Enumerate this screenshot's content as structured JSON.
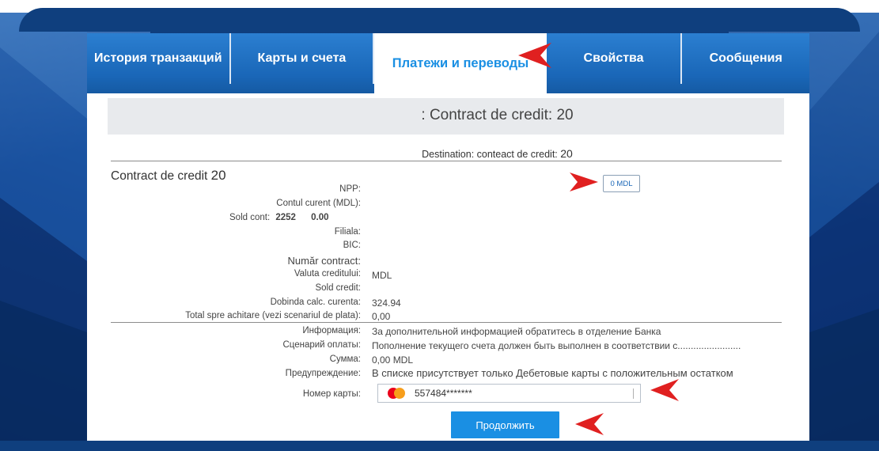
{
  "nav": {
    "tabs": [
      {
        "label": "История транзакций"
      },
      {
        "label": "Карты и счета"
      },
      {
        "label": "Платежи и переводы",
        "active": true
      },
      {
        "label": "Свойства"
      },
      {
        "label": "Сообщения"
      }
    ]
  },
  "header": {
    "title": ": Contract de credit: 20"
  },
  "destination": {
    "prefix": "Destination: conteact de credit:",
    "number": "20"
  },
  "contract": {
    "title": "Contract de credit",
    "number": "20",
    "amount_button": "0 MDL"
  },
  "details": {
    "npp_label": "NPP:",
    "contul_label": "Contul curent (MDL):",
    "sold_cont_label": "Sold cont:",
    "sold_cont_account": "2252",
    "sold_cont_value": "0.00",
    "filiala_label": "Filiala:",
    "bic_label": "BIC:",
    "numar_label": "Număr contract:",
    "valuta_label": "Valuta creditului:",
    "valuta_value": "MDL",
    "sold_credit_label": "Sold credit:",
    "dobinda_label": "Dobinda calc. curenta:",
    "dobinda_value": "324.94",
    "total_label": "Total spre achitare (vezi scenariul de plata):",
    "total_value": "0,00"
  },
  "payment": {
    "info_label": "Информация:",
    "info_value": "За дополнительной информацией обратитесь в отделение Банка",
    "scenario_label": "Сценарий оплаты:",
    "scenario_value": "Пополнение текущего счета должен быть выполнен в соответствии с........................",
    "sum_label": "Сумма:",
    "sum_value": "0,00 MDL",
    "warning_label": "Предупреждение:",
    "warning_value": "В списке присутствует только Дебетовые карты с положительным остатком",
    "card_label": "Номер карты:",
    "card_value": "557484*******",
    "card_icon": "mastercard-icon"
  },
  "actions": {
    "continue_label": "Продолжить"
  },
  "colors": {
    "accent": "#1a8fe3",
    "tabbar": "#1a67b8",
    "arrow": "#e02020",
    "background": "#0f3f7e"
  }
}
